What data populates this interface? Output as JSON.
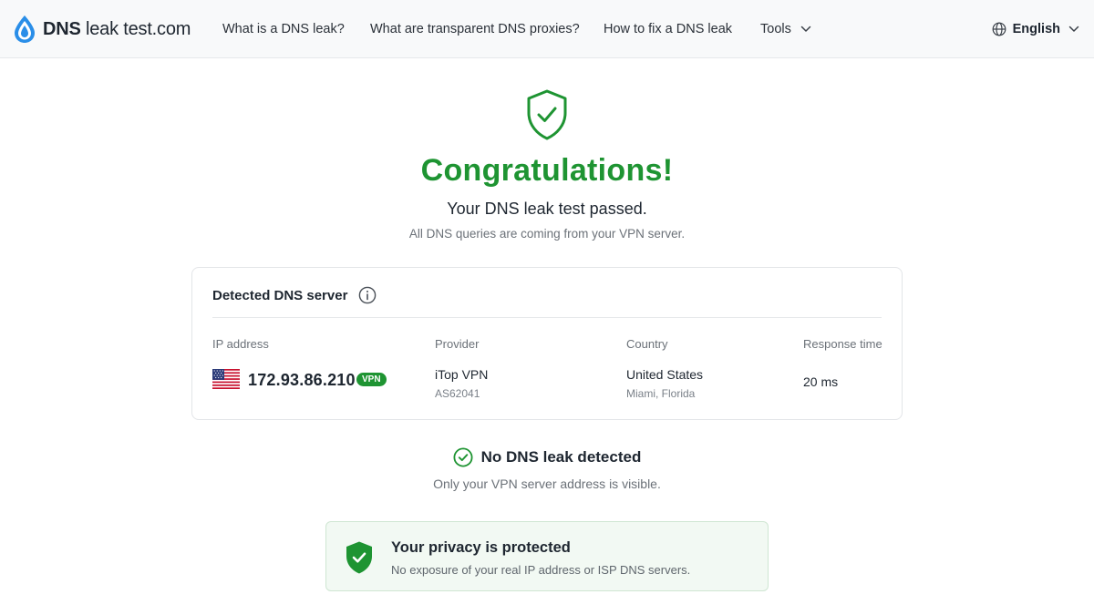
{
  "header": {
    "logo_bold": "DNS",
    "logo_rest": "leak test.com",
    "nav": [
      {
        "label": "What is a DNS leak?"
      },
      {
        "label": "What are transparent DNS proxies?"
      },
      {
        "label": "How to fix a DNS leak"
      },
      {
        "label": "Tools"
      }
    ],
    "language": "English"
  },
  "hero": {
    "icon": "shield-check-icon",
    "title": "Congratulations!",
    "subtitle": "Your DNS leak test passed.",
    "description": "All DNS queries are coming from your VPN server."
  },
  "card": {
    "title": "Detected DNS server",
    "columns": {
      "ip": "IP address",
      "provider": "Provider",
      "country": "Country",
      "response": "Response time"
    },
    "row": {
      "ip": "172.93.86.210",
      "badge": "VPN",
      "provider": "iTop VPN",
      "asn": "AS62041",
      "country": "United States",
      "city": "Miami, Florida",
      "response": "20 ms"
    }
  },
  "result": {
    "title": "No DNS leak detected",
    "subtitle": "Only your VPN server address is visible."
  },
  "privacy": {
    "title": "Your privacy is protected",
    "subtitle": "No exposure of your real IP address or ISP DNS servers."
  },
  "colors": {
    "accent_green": "#1e9432",
    "logo_blue": "#2a8ee8"
  }
}
